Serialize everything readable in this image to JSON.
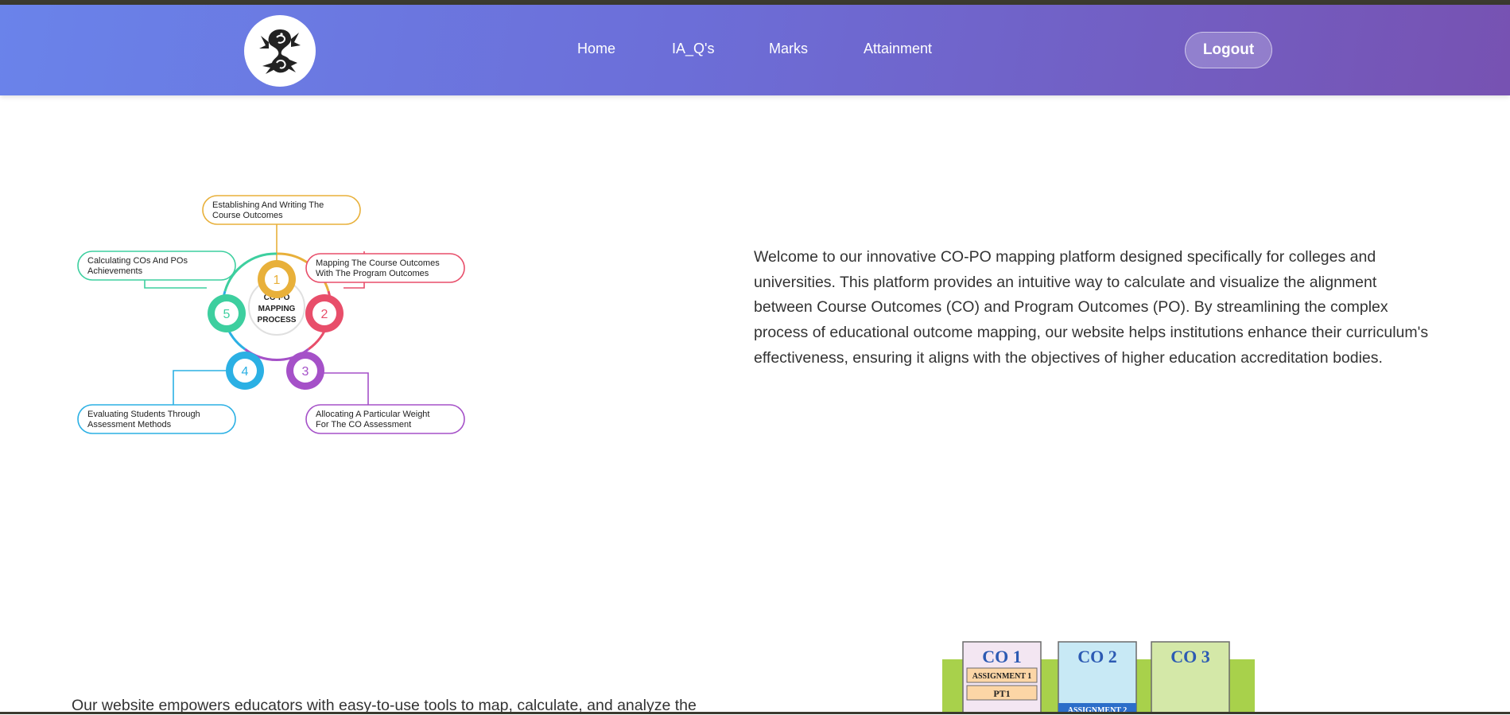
{
  "nav": {
    "links": [
      "Home",
      "IA_Q's",
      "Marks",
      "Attainment"
    ],
    "logout_label": "Logout"
  },
  "diagram": {
    "center_lines": [
      "CO-PO",
      "MAPPING",
      "PROCESS"
    ],
    "steps": [
      {
        "number": "1",
        "line1": "Establishing And Writing The",
        "line2": "Course Outcomes",
        "color": "#e8b03a"
      },
      {
        "number": "2",
        "line1": "Mapping The Course Outcomes",
        "line2": "With The Program Outcomes",
        "color": "#e84e6a"
      },
      {
        "number": "3",
        "line1": "Allocating A Particular Weight",
        "line2": "For The CO Assessment",
        "color": "#a551c8"
      },
      {
        "number": "4",
        "line1": "Evaluating Students Through",
        "line2": "Assessment Methods",
        "color": "#2bb0e4"
      },
      {
        "number": "5",
        "line1": "Calculating COs And POs",
        "line2": "Achievements",
        "color": "#3dcf9f"
      }
    ]
  },
  "intro_text": "Welcome to our innovative CO-PO mapping platform designed specifically for colleges and universities. This platform provides an intuitive way to calculate and visualize the alignment between Course Outcomes (CO) and Program Outcomes (PO). By streamlining the complex process of educational outcome mapping, our website helps institutions enhance their curriculum's effectiveness, ensuring it aligns with the objectives of higher education accreditation bodies.",
  "bottom_text": "Our website empowers educators with easy-to-use tools to map, calculate, and analyze the",
  "co_graphic": {
    "co1_title": "CO 1",
    "co1_items": [
      "ASSIGNMENT 1",
      "PT1"
    ],
    "co2_title": "CO 2",
    "co2_item": "ASSIGNMENT 2",
    "co3_title": "CO 3"
  }
}
